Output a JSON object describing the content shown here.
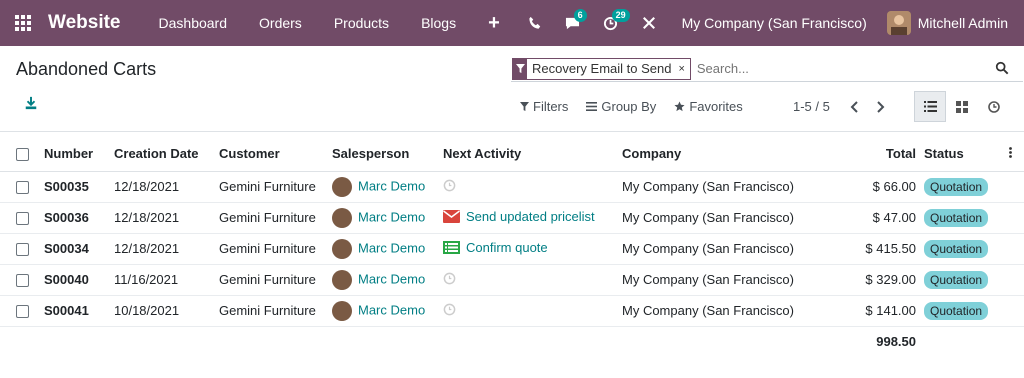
{
  "navbar": {
    "brand": "Website",
    "menu": [
      "Dashboard",
      "Orders",
      "Products",
      "Blogs"
    ],
    "plus": "+",
    "messages_count": "6",
    "activities_count": "29",
    "company": "My Company (San Francisco)",
    "user": "Mitchell Admin",
    "color": "#714B67"
  },
  "control": {
    "title": "Abandoned Carts",
    "facet_value": "Recovery Email to Send",
    "facet_remove": "×",
    "search_placeholder": "Search...",
    "filters_label": "Filters",
    "groupby_label": "Group By",
    "favorites_label": "Favorites",
    "pager_value": "1-5 / 5"
  },
  "table": {
    "columns": {
      "number": "Number",
      "creation_date": "Creation Date",
      "customer": "Customer",
      "salesperson": "Salesperson",
      "next_activity": "Next Activity",
      "company": "Company",
      "total": "Total",
      "status": "Status"
    },
    "rows": [
      {
        "number": "S00035",
        "date": "12/18/2021",
        "customer": "Gemini Furniture",
        "salesperson": "Marc Demo",
        "activity": "",
        "activity_icon": "clock-icon",
        "company": "My Company (San Francisco)",
        "total": "$ 66.00",
        "status": "Quotation"
      },
      {
        "number": "S00036",
        "date": "12/18/2021",
        "customer": "Gemini Furniture",
        "salesperson": "Marc Demo",
        "activity": "Send updated pricelist",
        "activity_icon": "envelope-icon",
        "company": "My Company (San Francisco)",
        "total": "$ 47.00",
        "status": "Quotation"
      },
      {
        "number": "S00034",
        "date": "12/18/2021",
        "customer": "Gemini Furniture",
        "salesperson": "Marc Demo",
        "activity": "Confirm quote",
        "activity_icon": "task-list-icon",
        "company": "My Company (San Francisco)",
        "total": "$ 415.50",
        "status": "Quotation"
      },
      {
        "number": "S00040",
        "date": "11/16/2021",
        "customer": "Gemini Furniture",
        "salesperson": "Marc Demo",
        "activity": "",
        "activity_icon": "clock-icon",
        "company": "My Company (San Francisco)",
        "total": "$ 329.00",
        "status": "Quotation"
      },
      {
        "number": "S00041",
        "date": "10/18/2021",
        "customer": "Gemini Furniture",
        "salesperson": "Marc Demo",
        "activity": "",
        "activity_icon": "clock-icon",
        "company": "My Company (San Francisco)",
        "total": "$ 141.00",
        "status": "Quotation"
      }
    ],
    "grand_total": "998.50"
  }
}
